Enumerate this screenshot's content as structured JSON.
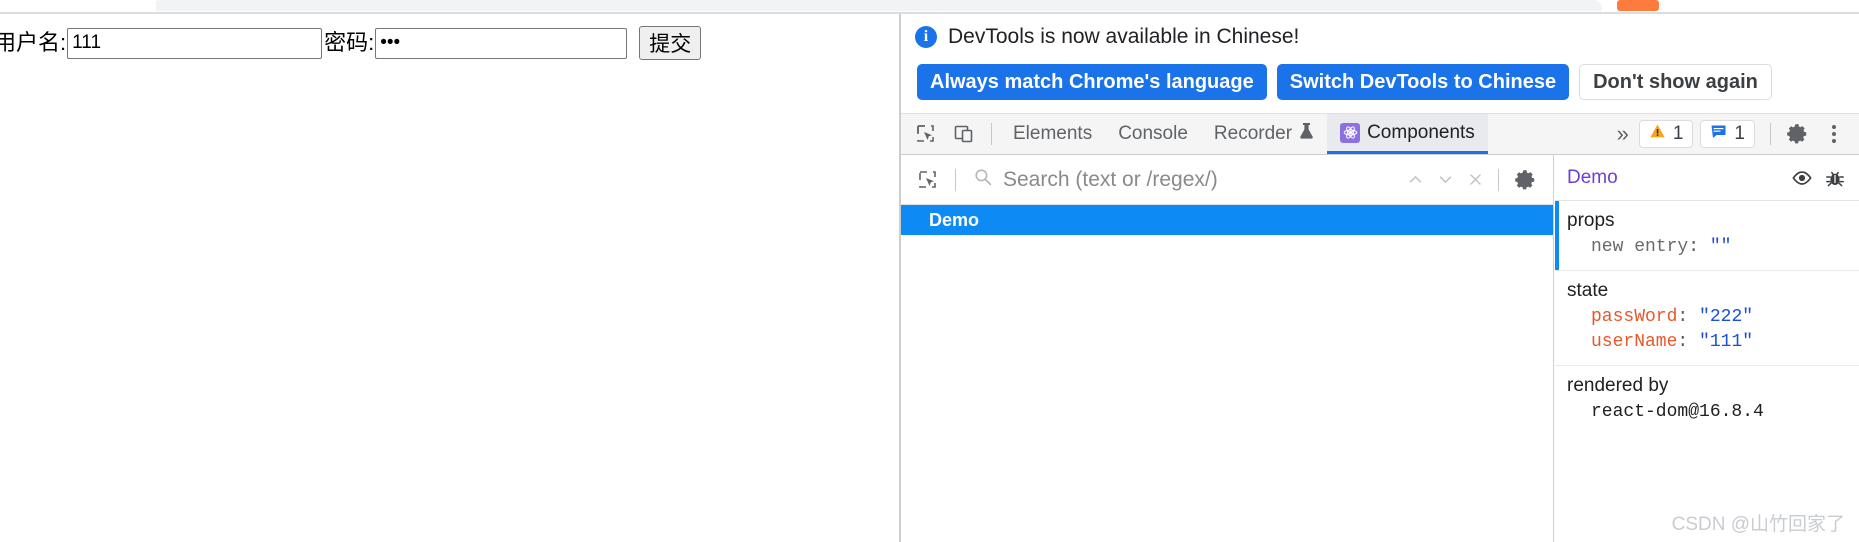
{
  "browser_chrome": {
    "orange_badge_label": ""
  },
  "page": {
    "username_label": "用户名:",
    "username_value": "111",
    "password_label": "密码:",
    "password_value": "222",
    "password_masked": "•••",
    "submit_label": "提交"
  },
  "notification": {
    "icon": "info-icon",
    "message": "DevTools is now available in Chinese!",
    "buttons": [
      {
        "label": "Always match Chrome's language",
        "style": "primary"
      },
      {
        "label": "Switch DevTools to Chinese",
        "style": "primary"
      },
      {
        "label": "Don't show again",
        "style": "secondary"
      }
    ]
  },
  "devtools_toolbar": {
    "icons": [
      {
        "name": "inspect-element-icon"
      },
      {
        "name": "device-toolbar-icon"
      }
    ],
    "tabs": [
      {
        "label": "Elements",
        "active": false,
        "icon": null
      },
      {
        "label": "Console",
        "active": false,
        "icon": null
      },
      {
        "label": "Recorder",
        "active": false,
        "icon": "flask-icon"
      },
      {
        "label": "Components",
        "active": true,
        "icon": "react-atom-icon"
      }
    ],
    "overflow_label": "»",
    "warning_count": "1",
    "message_count": "1",
    "settings_icon": "gear-icon",
    "more_icon": "kebab-menu-icon"
  },
  "components_panel": {
    "search": {
      "placeholder": "Search (text or /regex/)",
      "value": "",
      "inspect_icon": "select-component-icon",
      "search_icon": "search-icon",
      "prev_icon": "chevron-up-icon",
      "next_icon": "chevron-down-icon",
      "clear_icon": "close-icon",
      "settings_icon": "gear-icon"
    },
    "tree": [
      {
        "label": "Demo",
        "selected": true
      }
    ],
    "detail": {
      "component_name": "Demo",
      "inspect_dom_icon": "eye-icon",
      "debug_icon": "bug-icon",
      "sections": [
        {
          "title": "props",
          "rows": [
            {
              "key": "new entry",
              "key_style": "plain",
              "value": "\"\""
            }
          ]
        },
        {
          "title": "state",
          "rows": [
            {
              "key": "passWord",
              "key_style": "highlight",
              "value": "\"222\""
            },
            {
              "key": "userName",
              "key_style": "highlight",
              "value": "\"111\""
            }
          ]
        },
        {
          "title": "rendered by",
          "plain_lines": [
            "react-dom@16.8.4"
          ]
        }
      ]
    }
  },
  "watermark": {
    "text": "CSDN @山竹回家了"
  },
  "colors": {
    "accent_blue": "#1a73e8",
    "selection_blue": "#0e8af5",
    "react_purple": "#8c6fe0",
    "key_orange": "#e8582b",
    "value_blue": "#1a4fd6",
    "warning_yellow": "#f5a623",
    "tab_orange": "#ff7a3d"
  }
}
